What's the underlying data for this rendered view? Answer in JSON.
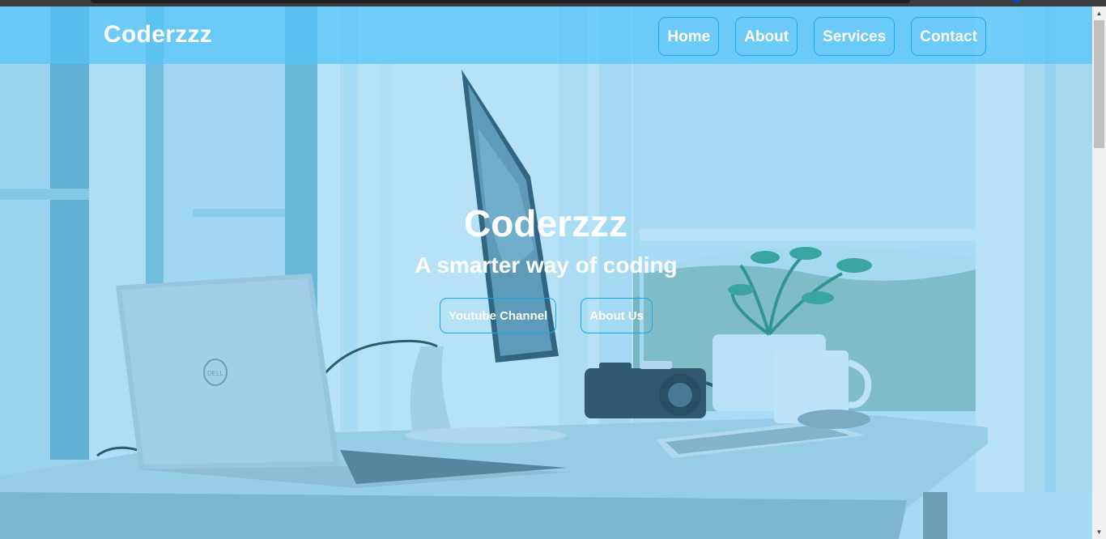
{
  "navbar": {
    "brand": "Coderzzz",
    "links": [
      {
        "label": "Home"
      },
      {
        "label": "About"
      },
      {
        "label": "Services"
      },
      {
        "label": "Contact"
      }
    ]
  },
  "hero": {
    "title": "Coderzzz",
    "subtitle": "A smarter way of coding",
    "buttons": [
      {
        "label": "Youtube Channel"
      },
      {
        "label": "About Us"
      }
    ]
  },
  "laptop_logo": "DELL",
  "colors": {
    "overlay": "#3cafeb",
    "navbar": "#56c4fa",
    "button_border": "#1aa7ef",
    "text": "#ffffff"
  },
  "icons": {
    "scroll_up": "scroll-up-arrow-icon",
    "scroll_down": "scroll-down-arrow-icon"
  }
}
